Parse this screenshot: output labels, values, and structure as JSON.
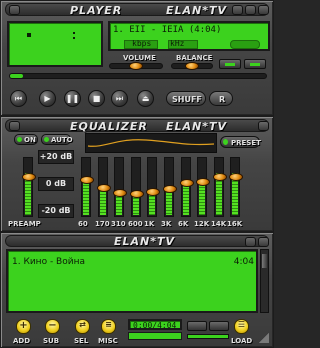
{
  "player": {
    "title": "PLAYER",
    "brand": "ELAN*TV",
    "track_display": "1.  ЕII  -  IEIA  (4:04)",
    "lcd_labels": [
      "kbps",
      "kHz"
    ],
    "volume_label": "VOLUME",
    "balance_label": "BALANCE",
    "volume_level": 0.5,
    "balance_level": 0.5,
    "position_level": 0.05,
    "shuffle_label": "SHUFF",
    "repeat_label": "R",
    "eject_icon": "eject-icon",
    "transport_icons": [
      "prev-icon",
      "play-icon",
      "pause-icon",
      "stop-icon",
      "next-icon"
    ]
  },
  "equalizer": {
    "title": "EQUALIZER",
    "brand": "ELAN*TV",
    "on_label": "ON",
    "auto_label": "AUTO",
    "preset_label": "PRESET",
    "db_top": "+20 dB",
    "db_mid": "0 dB",
    "db_bottom": "-20 dB",
    "preamp_label": "PREAMP",
    "preamp_level": 0.72,
    "bands": [
      {
        "label": "60",
        "level": 0.65
      },
      {
        "label": "170",
        "level": 0.5
      },
      {
        "label": "310",
        "level": 0.4
      },
      {
        "label": "600",
        "level": 0.38
      },
      {
        "label": "1K",
        "level": 0.42
      },
      {
        "label": "3K",
        "level": 0.48
      },
      {
        "label": "6K",
        "level": 0.6
      },
      {
        "label": "12K",
        "level": 0.62
      },
      {
        "label": "14K",
        "level": 0.72
      },
      {
        "label": "16K",
        "level": 0.72
      }
    ]
  },
  "playlist": {
    "brand": "ELAN*TV",
    "items": [
      {
        "title": "1. Кино - Война",
        "duration": "4:04"
      }
    ],
    "time_display": "0:00/4:04",
    "buttons": [
      "ADD",
      "SUB",
      "SEL",
      "MISC",
      "LOAD"
    ],
    "accent": "#3cd21e"
  }
}
